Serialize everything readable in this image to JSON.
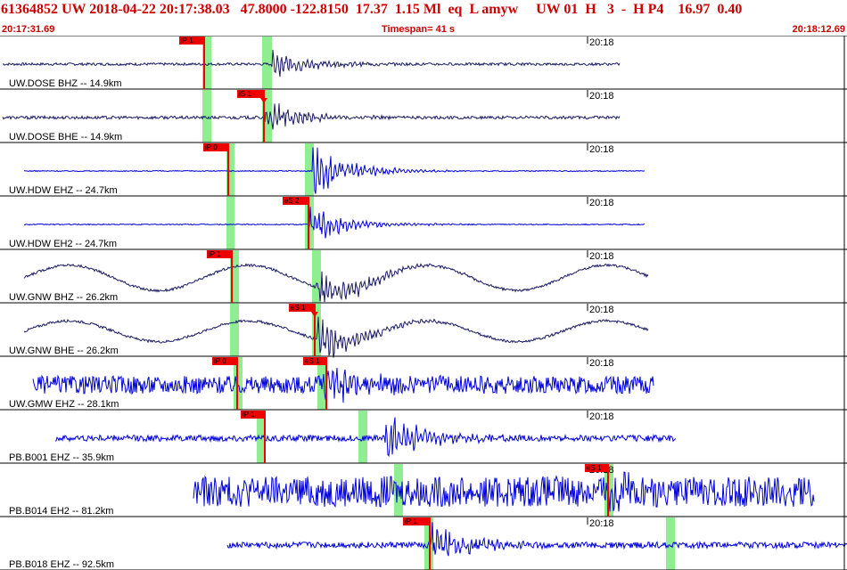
{
  "header": {
    "title": "61364852 UW 2018-04-22 20:17:38.03   47.8000 -122.8150  17.37  1.15 Ml  eq  L amyw     UW 01  H   3  -  H P4    16.97  0.40",
    "start_time": "20:17:31.69",
    "timespan": "Timespan=  41 s",
    "end_time": "20:18:12.69"
  },
  "colors": {
    "trace_dark": "#1a1a66",
    "trace_blue": "#0000dd",
    "pick_bg": "#ee0000",
    "window_green": "#90ee90",
    "border": "#000000"
  },
  "time_mark_label": "20:18",
  "channels": [
    {
      "label": "UW.DOSE BHZ -- 14.9km",
      "color": "dark",
      "noise": 0.05,
      "long": 0,
      "arrival": 305,
      "s_amp": 0.55
    },
    {
      "label": "UW.DOSE BHE -- 14.9km",
      "color": "dark",
      "noise": 0.06,
      "long": 0,
      "arrival": 297,
      "s_amp": 0.65
    },
    {
      "label": "UW.HDW EHZ -- 24.7km",
      "color": "blue",
      "noise": 0.02,
      "long": 0,
      "arrival": 350,
      "s_amp": 0.95
    },
    {
      "label": "UW.HDW EH2 -- 24.7km",
      "color": "blue",
      "noise": 0.02,
      "long": 0,
      "arrival": 347,
      "s_amp": 0.7
    },
    {
      "label": "UW.GNW BHZ -- 26.2km",
      "color": "dark",
      "noise": 0.05,
      "long": 0.55,
      "arrival": 355,
      "s_amp": 0.9
    },
    {
      "label": "UW.GNW BHE -- 26.2km",
      "color": "dark",
      "noise": 0.05,
      "long": 0.45,
      "arrival": 356,
      "s_amp": 0.9
    },
    {
      "label": "UW.GMW EHZ -- 28.1km",
      "color": "blue",
      "noise": 0.35,
      "long": 0,
      "arrival": 362,
      "s_amp": 0.85
    },
    {
      "label": "PB.B001 EHZ -- 35.9km",
      "color": "blue",
      "noise": 0.12,
      "long": 0,
      "arrival": 432,
      "s_amp": 0.9
    },
    {
      "label": "PB.B014 EH2 -- 81.2km",
      "color": "blue",
      "noise": 0.6,
      "long": 0,
      "arrival": 680,
      "s_amp": 0.5
    },
    {
      "label": "PB.B018 EHZ -- 92.5km",
      "color": "blue",
      "noise": 0.12,
      "long": 0,
      "arrival": 484,
      "s_amp": 0.8
    }
  ],
  "picks": [
    {
      "label": "iP 1"
    },
    {
      "label": "iS 1"
    },
    {
      "label": "iP 0"
    },
    {
      "label": "eS 2"
    },
    {
      "label": "iP 1"
    },
    {
      "label": "eS 1"
    },
    {
      "label": "iP 0"
    },
    {
      "label": "eS 1"
    },
    {
      "label": "iP 1"
    },
    {
      "label": "eS 1"
    },
    {
      "label": "iP 1"
    }
  ]
}
